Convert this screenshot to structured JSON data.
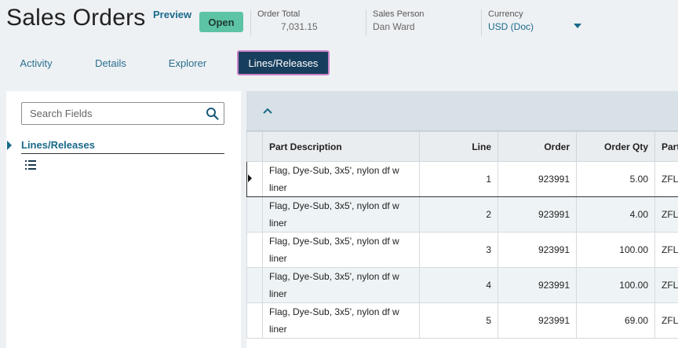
{
  "header": {
    "title": "Sales Orders",
    "preview_label": "Preview",
    "status": "Open",
    "order_total_label": "Order Total",
    "order_total_value": "7,031.15",
    "sales_person_label": "Sales Person",
    "sales_person_value": "Dan Ward",
    "currency_label": "Currency",
    "currency_value": "USD (Doc)"
  },
  "tabs": [
    {
      "label": "Activity"
    },
    {
      "label": "Details"
    },
    {
      "label": "Explorer"
    },
    {
      "label": "Lines/Releases",
      "active": true
    }
  ],
  "left_panel": {
    "search_placeholder": "Search Fields",
    "tree_item": "Lines/Releases"
  },
  "grid": {
    "columns": [
      "Part Description",
      "Line",
      "Order",
      "Order Qty",
      "Part"
    ],
    "rows": [
      {
        "desc": "Flag, Dye-Sub, 3x5', nylon df w liner",
        "line": "1",
        "order": "923991",
        "qty": "5.00",
        "part": "ZFL"
      },
      {
        "desc": "Flag, Dye-Sub, 3x5', nylon df w liner",
        "line": "2",
        "order": "923991",
        "qty": "4.00",
        "part": "ZFL"
      },
      {
        "desc": "Flag, Dye-Sub, 3x5', nylon df w liner",
        "line": "3",
        "order": "923991",
        "qty": "100.00",
        "part": "ZFL"
      },
      {
        "desc": "Flag, Dye-Sub, 3x5', nylon df w liner",
        "line": "4",
        "order": "923991",
        "qty": "100.00",
        "part": "ZFL"
      },
      {
        "desc": "Flag, Dye-Sub, 3x5', nylon df w liner",
        "line": "5",
        "order": "923991",
        "qty": "69.00",
        "part": "ZFL"
      }
    ]
  },
  "colors": {
    "accent": "#1a6a8a",
    "status_badge": "#5cc3a5",
    "active_tab": "#173e5d"
  },
  "icons": [
    "search-icon",
    "chevron-up-icon",
    "list-icon",
    "caret-down-icon",
    "caret-right-icon"
  ]
}
